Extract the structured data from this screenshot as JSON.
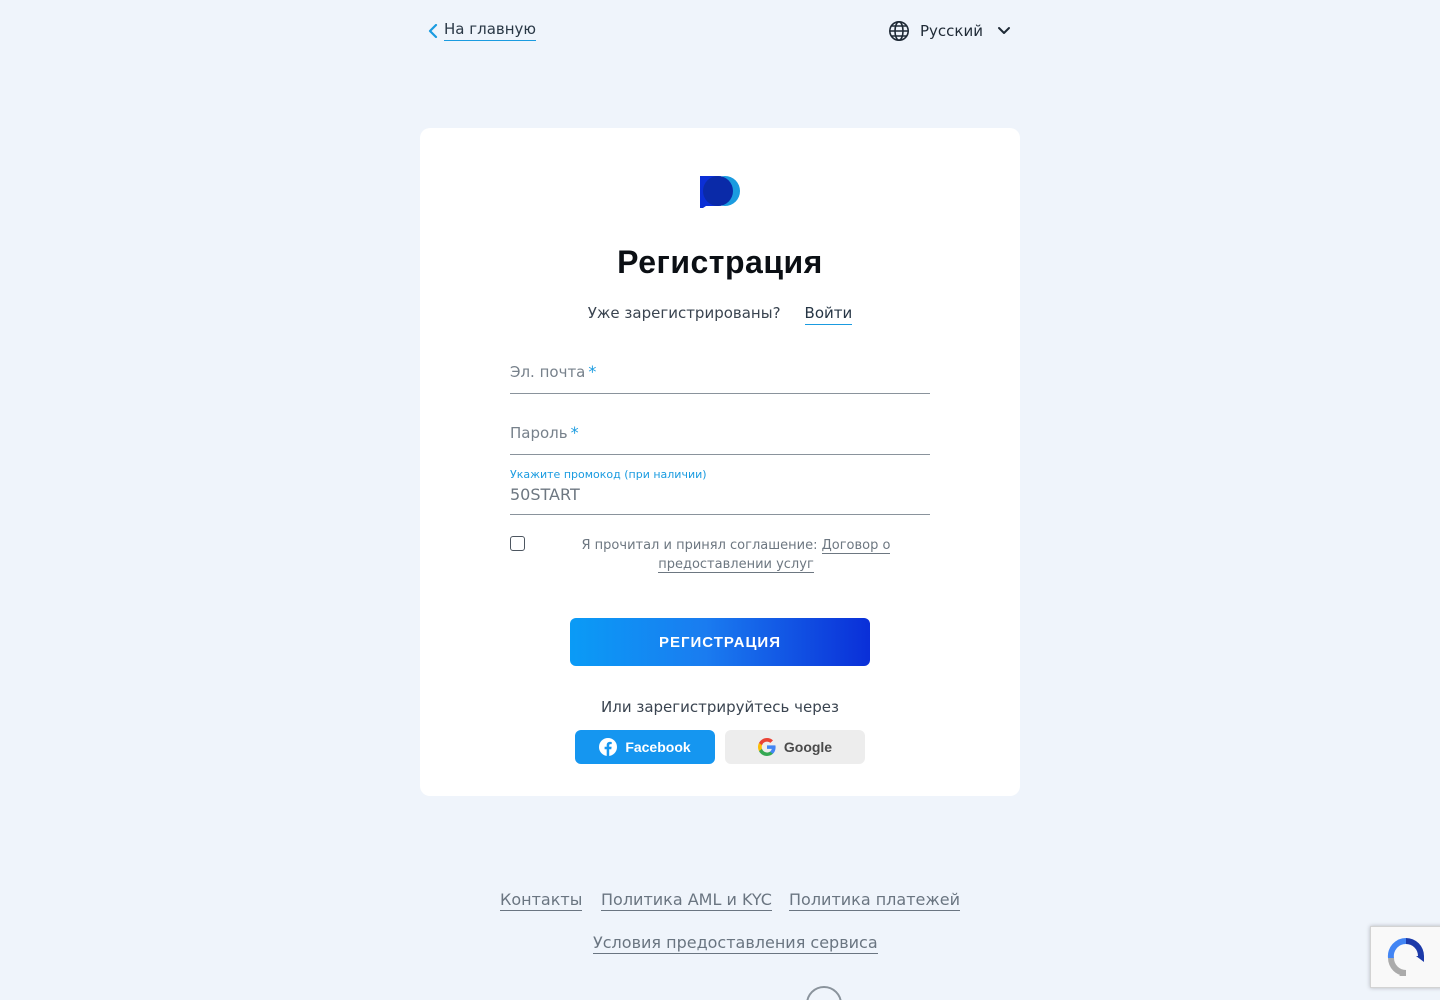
{
  "header": {
    "back_label": "На главную",
    "language": "Русский"
  },
  "colors": {
    "accent": "#1a9be0",
    "button_start": "#0a9bf6",
    "button_end": "#0a2fd8",
    "background": "#eff4fb"
  },
  "form": {
    "title": "Регистрация",
    "already_registered": "Уже зарегистрированы?",
    "login_link": "Войти",
    "email_placeholder": "Эл. почта",
    "password_placeholder": "Пароль",
    "required_mark": "*",
    "promo_label": "Укажите промокод (при наличии)",
    "promo_value": "50START",
    "agree_text": "Я прочитал и принял соглашение: ",
    "agree_link": "Договор о предоставлении услуг",
    "agree_checked": false,
    "submit_label": "РЕГИСТРАЦИЯ",
    "or_text": "Или зарегистрируйтесь через",
    "facebook_label": "Facebook",
    "google_label": "Google"
  },
  "footer": {
    "links": [
      "Контакты",
      "Политика AML и KYC",
      "Политика платежей",
      "Условия предоставления сервиса"
    ]
  },
  "icons": {
    "back": "chevron-left-icon",
    "language": "globe-icon",
    "dropdown": "chevron-down-icon",
    "facebook": "facebook-icon",
    "google": "google-icon",
    "recaptcha": "recaptcha-icon"
  }
}
